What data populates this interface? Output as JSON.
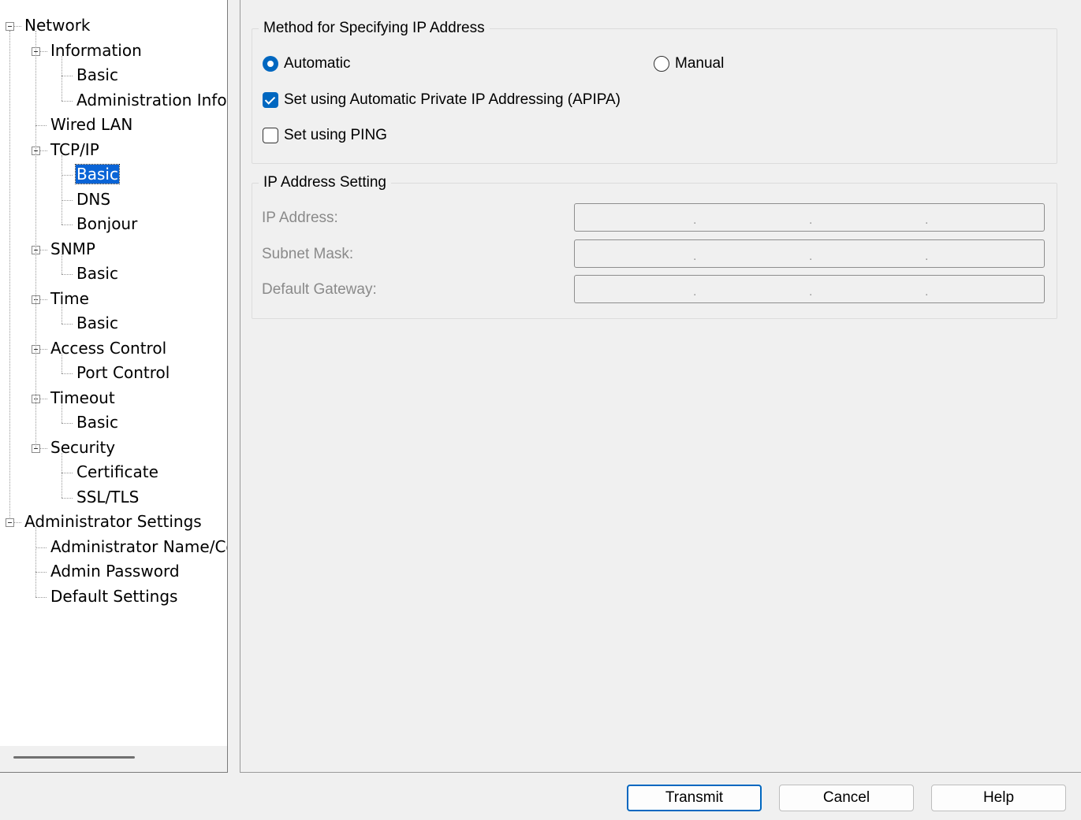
{
  "tree": [
    {
      "label": "Network",
      "level": 0,
      "expandable": true
    },
    {
      "label": "Information",
      "level": 1,
      "expandable": true
    },
    {
      "label": "Basic",
      "level": 2,
      "expandable": false
    },
    {
      "label": "Administration Infori",
      "level": 2,
      "expandable": false
    },
    {
      "label": "Wired LAN",
      "level": 1,
      "expandable": false
    },
    {
      "label": "TCP/IP",
      "level": 1,
      "expandable": true
    },
    {
      "label": "Basic",
      "level": 2,
      "expandable": false,
      "selected": true
    },
    {
      "label": "DNS",
      "level": 2,
      "expandable": false
    },
    {
      "label": "Bonjour",
      "level": 2,
      "expandable": false
    },
    {
      "label": "SNMP",
      "level": 1,
      "expandable": true
    },
    {
      "label": "Basic",
      "level": 2,
      "expandable": false
    },
    {
      "label": "Time",
      "level": 1,
      "expandable": true
    },
    {
      "label": "Basic",
      "level": 2,
      "expandable": false
    },
    {
      "label": "Access Control",
      "level": 1,
      "expandable": true
    },
    {
      "label": "Port Control",
      "level": 2,
      "expandable": false
    },
    {
      "label": "Timeout",
      "level": 1,
      "expandable": true
    },
    {
      "label": "Basic",
      "level": 2,
      "expandable": false
    },
    {
      "label": "Security",
      "level": 1,
      "expandable": true
    },
    {
      "label": "Certificate",
      "level": 2,
      "expandable": false
    },
    {
      "label": "SSL/TLS",
      "level": 2,
      "expandable": false
    },
    {
      "label": "Administrator Settings",
      "level": 0,
      "expandable": true
    },
    {
      "label": "Administrator Name/Co",
      "level": 1,
      "expandable": false
    },
    {
      "label": "Admin Password",
      "level": 1,
      "expandable": false
    },
    {
      "label": "Default Settings",
      "level": 1,
      "expandable": false
    }
  ],
  "method_group": {
    "title": "Method for Specifying IP Address",
    "automatic_label": "Automatic",
    "automatic_selected": true,
    "manual_label": "Manual",
    "manual_selected": false,
    "apipa_label": "Set using Automatic Private IP Addressing (APIPA)",
    "apipa_checked": true,
    "ping_label": "Set using PING",
    "ping_checked": false
  },
  "ip_group": {
    "title": "IP Address Setting",
    "ip_label": "IP Address:",
    "subnet_label": "Subnet Mask:",
    "gateway_label": "Default Gateway:",
    "octet_separator": "."
  },
  "buttons": {
    "transmit": "Transmit",
    "cancel": "Cancel",
    "help": "Help"
  }
}
